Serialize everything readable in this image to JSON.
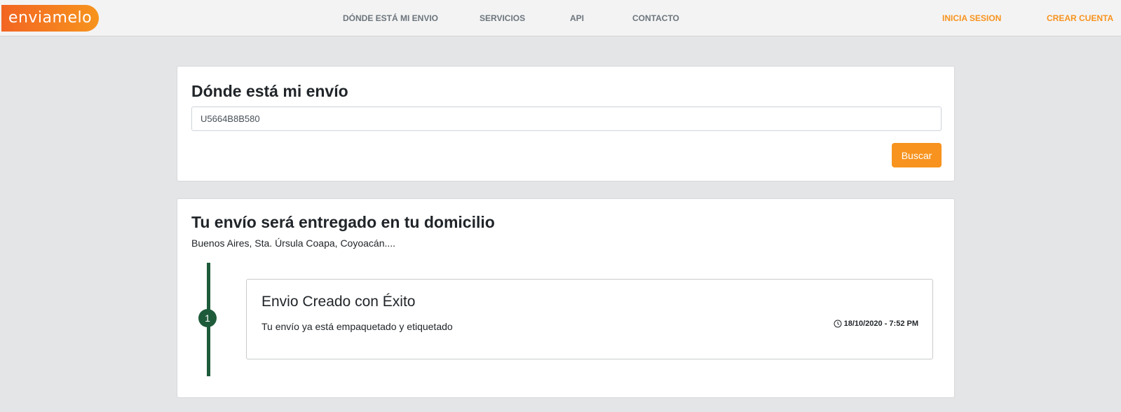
{
  "brand": {
    "logo_text": "enviamelo",
    "primary_color": "#f7931e",
    "gradient_start": "#f26522",
    "timeline_color": "#1e5b3a"
  },
  "nav": {
    "links": [
      "DÓNDE ESTÁ MI ENVIO",
      "SERVICIOS",
      "API",
      "CONTACTO"
    ],
    "login": "INICIA SESION",
    "signup": "CREAR CUENTA"
  },
  "search": {
    "title": "Dónde está mi envío",
    "tracking_value": "U5664B8B580",
    "button_label": "Buscar"
  },
  "result": {
    "title": "Tu envío será entregado en tu domicilio",
    "address": "Buenos Aires, Sta. Úrsula Coapa, Coyoacán....",
    "events": [
      {
        "step": "1",
        "title": "Envio Creado con Éxito",
        "description": "Tu envío ya está empaquetado y etiquetado",
        "timestamp": "18/10/2020 - 7:52 PM",
        "icon": "clock-icon"
      }
    ]
  }
}
